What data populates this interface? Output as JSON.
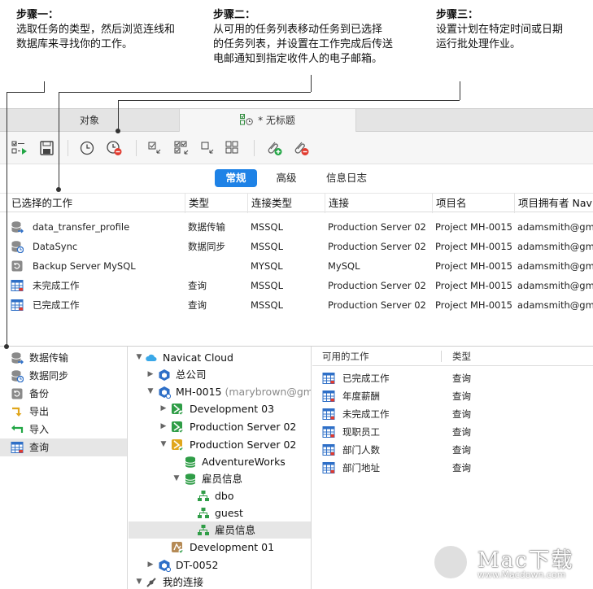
{
  "steps": [
    {
      "title": "步骤一：",
      "line1": "选取任务的类型，然后浏览连线和",
      "line2": "数据库来寻找你的工作。"
    },
    {
      "title": "步骤二：",
      "line1": "从可用的任务列表移动任务到已选择",
      "line2": "的任务列表，并设置在工作完成后传送",
      "line3": "电邮通知到指定收件人的电子邮箱。"
    },
    {
      "title": "步骤三：",
      "line1": "设置计划在特定时间或日期",
      "line2": "运行批处理作业。"
    }
  ],
  "tabs": {
    "objects": "对象",
    "untitled": "* 无标题"
  },
  "segments": {
    "general": "常规",
    "advanced": "高级",
    "log": "信息日志"
  },
  "job_table": {
    "headers": [
      "已选择的工作",
      "类型",
      "连接类型",
      "连接",
      "项目名",
      "项目拥有者 Nav"
    ],
    "rows": [
      {
        "name": "data_transfer_profile",
        "type": "数据传输",
        "conn_type": "MSSQL",
        "conn": "Production Server 02",
        "project": "Project MH-0015",
        "owner": "adamsmith@gma",
        "icon": "data-transfer-icon"
      },
      {
        "name": "DataSync",
        "type": "数据同步",
        "conn_type": "MSSQL",
        "conn": "Production Server 02",
        "project": "Project MH-0015",
        "owner": "adamsmith@gma",
        "icon": "data-sync-icon"
      },
      {
        "name": "Backup Server MySQL",
        "type": "",
        "conn_type": "MYSQL",
        "conn": "MySQL",
        "project": "Project MH-0015",
        "owner": "adamsmith@gma",
        "icon": "backup-icon"
      },
      {
        "name": "未完成工作",
        "type": "查询",
        "conn_type": "MSSQL",
        "conn": "Production Server 02",
        "project": "Project MH-0015",
        "owner": "adamsmith@gma",
        "icon": "query-icon"
      },
      {
        "name": "已完成工作",
        "type": "查询",
        "conn_type": "MSSQL",
        "conn": "Production Server 02",
        "project": "Project MH-0015",
        "owner": "adamsmith@gma",
        "icon": "query-icon"
      }
    ]
  },
  "job_types": [
    {
      "label": "数据传输",
      "icon": "data-transfer-icon"
    },
    {
      "label": "数据同步",
      "icon": "data-sync-icon"
    },
    {
      "label": "备份",
      "icon": "backup-icon"
    },
    {
      "label": "导出",
      "icon": "export-icon"
    },
    {
      "label": "导入",
      "icon": "import-icon"
    },
    {
      "label": "查询",
      "icon": "query-icon"
    }
  ],
  "tree": {
    "cloud": "Navicat Cloud",
    "hq": "总公司",
    "mh": "MH-0015",
    "mh_owner": "(marybrown@gm...",
    "dev03": "Development 03",
    "prod02a": "Production Server 02",
    "prod02b": "Production Server 02",
    "adventure": "AdventureWorks",
    "employees": "雇员信息",
    "dbo": "dbo",
    "guest": "guest",
    "employees_schema": "雇员信息",
    "dev01": "Development 01",
    "dt": "DT-0052",
    "mine": "我的连接"
  },
  "available": {
    "headers": {
      "name": "可用的工作",
      "type": "类型"
    },
    "rows": [
      {
        "name": "已完成工作",
        "type": "查询"
      },
      {
        "name": "年度薪酬",
        "type": "查询"
      },
      {
        "name": "未完成工作",
        "type": "查询"
      },
      {
        "name": "现职员工",
        "type": "查询"
      },
      {
        "name": "部门人数",
        "type": "查询"
      },
      {
        "name": "部门地址",
        "type": "查询"
      }
    ]
  },
  "watermark": {
    "brand": "Mac下载",
    "url": "www.Macdown.com"
  },
  "colors": {
    "accent": "#1e82e6",
    "ok_green": "#22a645",
    "query_blue": "#2e6fc7"
  }
}
